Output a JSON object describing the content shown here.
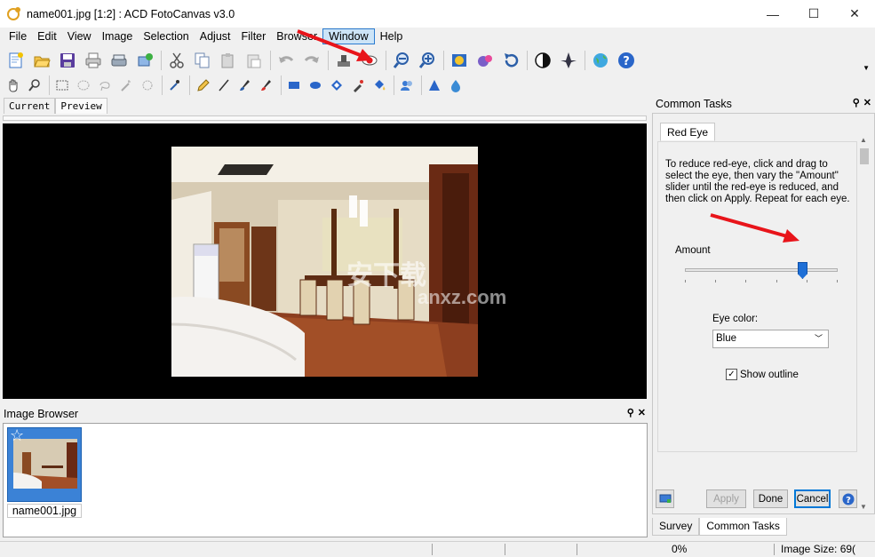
{
  "window": {
    "title": "name001.jpg [1:2] : ACD FotoCanvas v3.0",
    "minimize_glyph": "—",
    "maximize_glyph": "☐",
    "close_glyph": "✕"
  },
  "menu": [
    "File",
    "Edit",
    "View",
    "Image",
    "Selection",
    "Adjust",
    "Filter",
    "Browser",
    "Window",
    "Help"
  ],
  "view_tabs": [
    "Current",
    "Preview"
  ],
  "image_browser": {
    "title": "Image Browser",
    "thumbnail_label": "name001.jpg"
  },
  "common_tasks": {
    "title": "Common Tasks",
    "tab": "Red Eye",
    "instructions": "To reduce red-eye, click and drag to select the eye, then vary the \"Amount\" slider until the red-eye is reduced, and then click on Apply.  Repeat for each eye.",
    "amount_label": "Amount",
    "amount_value": 0.77,
    "eye_color_label": "Eye color:",
    "eye_color_value": "Blue",
    "show_outline_label": "Show outline",
    "show_outline_checked": true,
    "apply_label": "Apply",
    "done_label": "Done",
    "cancel_label": "Cancel",
    "help_glyph": "?"
  },
  "bottom_tabs": [
    "Survey",
    "Common Tasks"
  ],
  "status": {
    "percent": "0%",
    "image_size": "Image Size: 69("
  },
  "watermark": {
    "text": "安下载",
    "sub": "anxz.com"
  },
  "colors": {
    "accent": "#1e6fd6",
    "annotation_arrow": "#e8141a"
  }
}
